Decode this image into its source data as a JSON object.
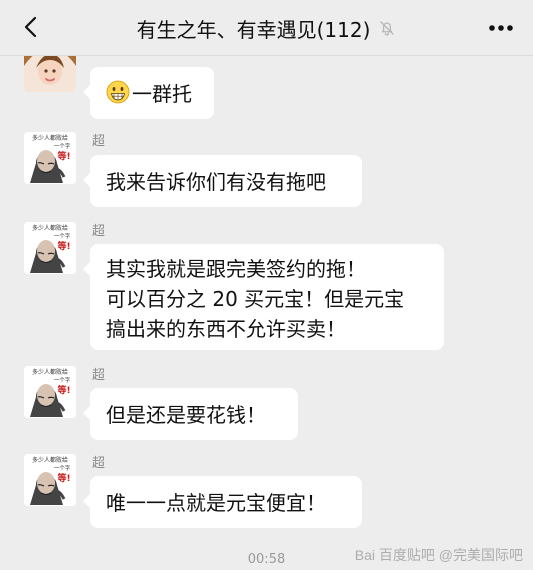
{
  "header": {
    "title": "有生之年、有幸遇见(112)",
    "back_icon": "chevron-left-icon",
    "mute_icon": "bell-off-icon",
    "more_icon": "more-horizontal-icon"
  },
  "messages": [
    {
      "sender": "",
      "avatar": "woman-photo-avatar",
      "lines": [
        "一群托"
      ],
      "emoji": "grinning-face-icon"
    },
    {
      "sender": "超",
      "avatar": "meme-avatar",
      "lines": [
        "我来告诉你们有没有拖吧"
      ]
    },
    {
      "sender": "超",
      "avatar": "meme-avatar",
      "lines": [
        "其实我就是跟完美签约的拖！",
        "可以百分之 20 买元宝！但是元宝",
        "搞出来的东西不允许买卖！"
      ]
    },
    {
      "sender": "超",
      "avatar": "meme-avatar",
      "lines": [
        "但是还是要花钱！"
      ]
    },
    {
      "sender": "超",
      "avatar": "meme-avatar",
      "lines": [
        "唯一一点就是元宝便宜！"
      ]
    }
  ],
  "meme_avatar_text": {
    "line1": "多少人都败给",
    "line2": "一个字",
    "line3": "等!"
  },
  "footer": {
    "time": "00:58",
    "watermark": "Bai 百度贴吧 @完美国际吧"
  }
}
